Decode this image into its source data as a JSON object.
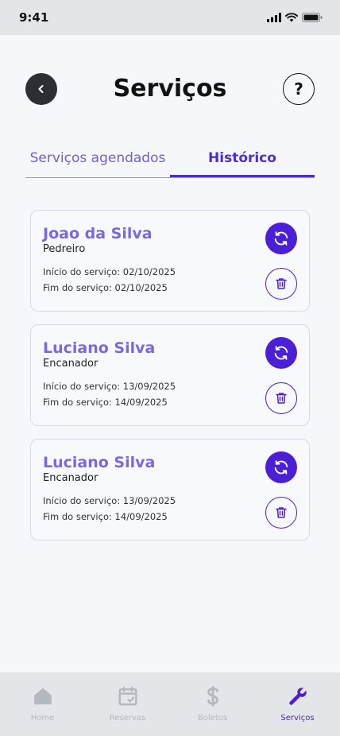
{
  "status_bar": {
    "time": "9:41"
  },
  "header": {
    "title": "Serviços",
    "help_label": "?"
  },
  "tabs": [
    {
      "label": "Serviços agendados",
      "active": false
    },
    {
      "label": "Histórico",
      "active": true
    }
  ],
  "services": [
    {
      "name": "Joao da Silva",
      "role": "Pedreiro",
      "start": "Início do serviço: 02/10/2025",
      "end": "Fim do serviço: 02/10/2025"
    },
    {
      "name": "Luciano Silva",
      "role": "Encanador",
      "start": "Início do serviço: 13/09/2025",
      "end": "Fim do serviço: 14/09/2025"
    },
    {
      "name": "Luciano Silva",
      "role": "Encanador",
      "start": "Início do serviço: 13/09/2025",
      "end": "Fim do serviço: 14/09/2025"
    }
  ],
  "bottom_nav": [
    {
      "label": "Home",
      "icon": "home-icon",
      "active": false
    },
    {
      "label": "Reservas",
      "icon": "calendar-check-icon",
      "active": false
    },
    {
      "label": "Boletos",
      "icon": "dollar-icon",
      "active": false
    },
    {
      "label": "Serviços",
      "icon": "wrench-icon",
      "active": true
    }
  ],
  "colors": {
    "accent": "#4b1fd6",
    "name_text": "#7b68df",
    "tab_inactive": "#6f62c8",
    "nav_inactive": "#b4b8bf"
  }
}
